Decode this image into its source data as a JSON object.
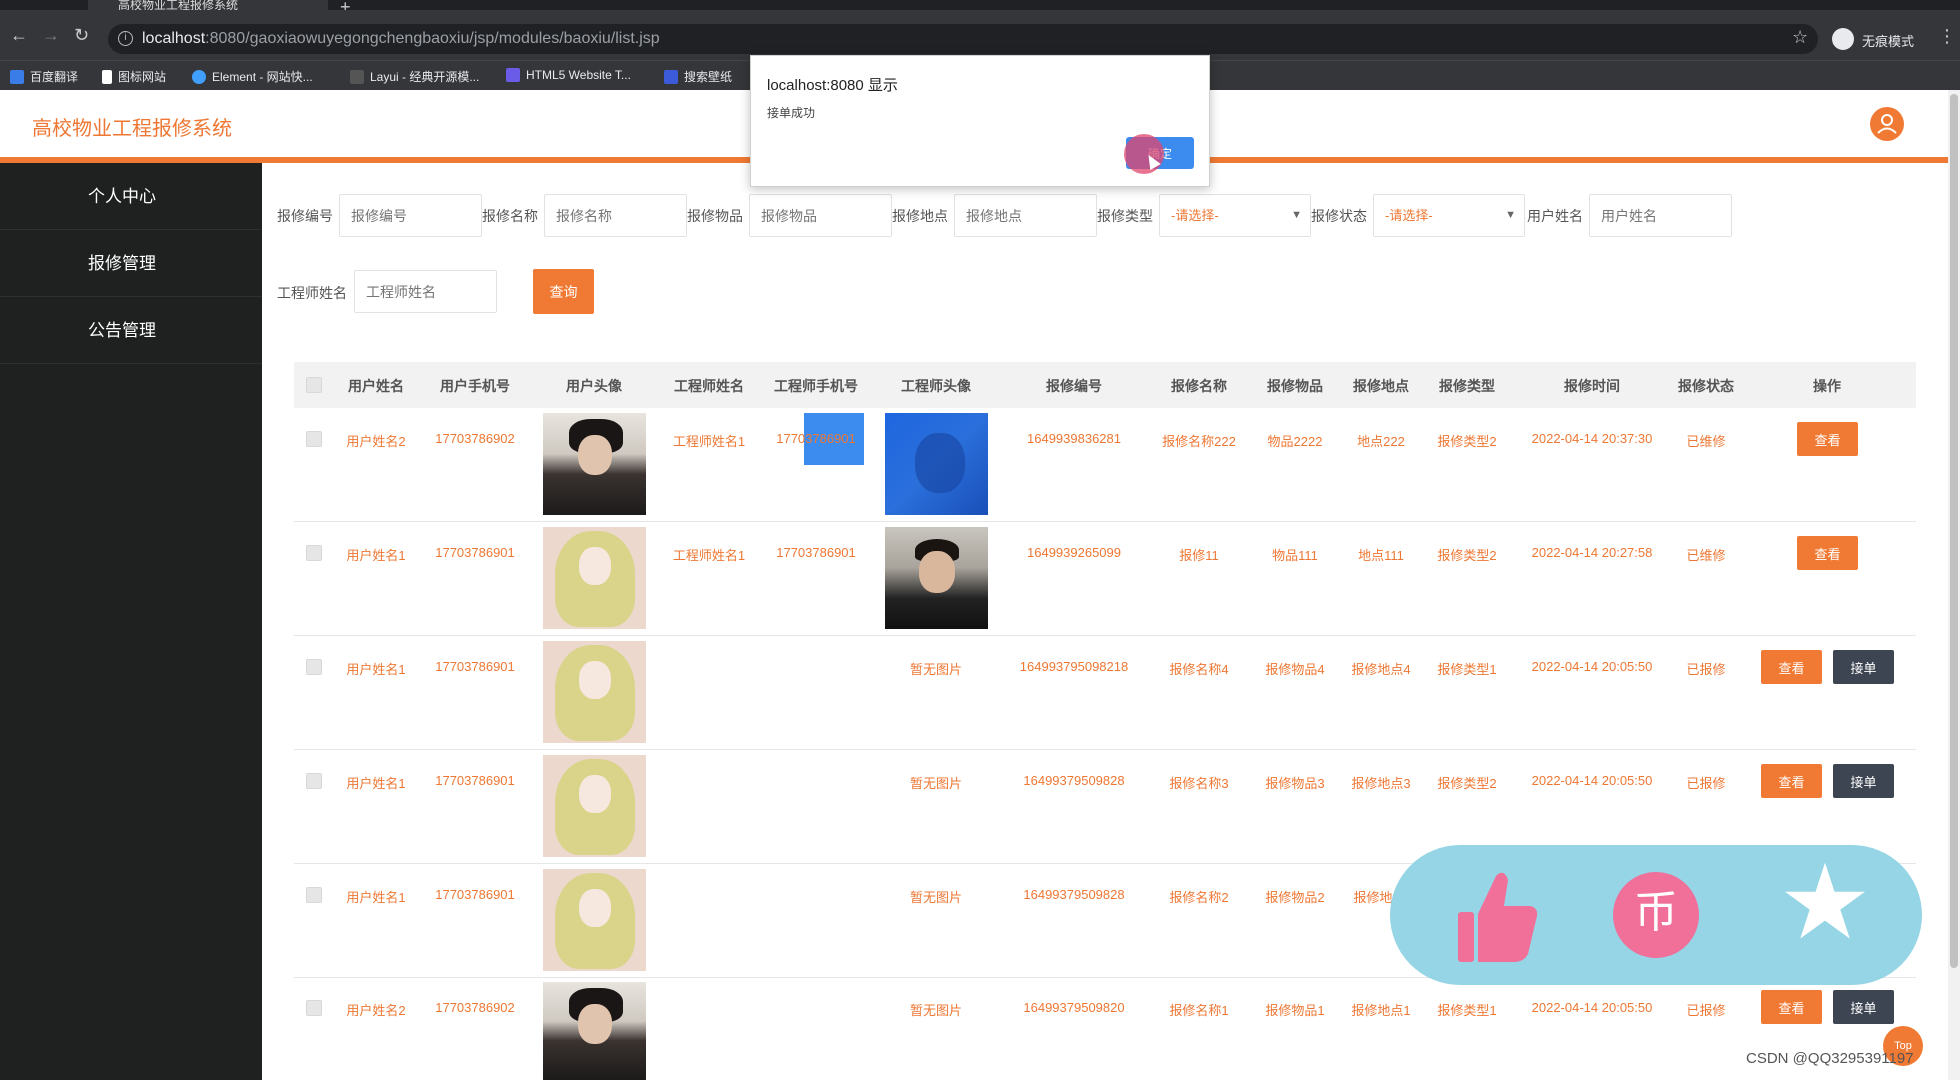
{
  "browser": {
    "tab_title": "高校物业工程报修系统",
    "url_host": "localhost",
    "url_path": ":8080/gaoxiaowuyegongchengbaoxiu/jsp/modules/baoxiu/list.jsp",
    "incognito_label": "无痕模式",
    "bookmarks": [
      "百度翻译",
      "图标网站",
      "Element - 网站快...",
      "Layui - 经典开源模...",
      "HTML5 Website T...",
      "搜索壁纸"
    ]
  },
  "app": {
    "title": "高校物业工程报修系统"
  },
  "sidebar": {
    "items": [
      "个人中心",
      "报修管理",
      "公告管理"
    ]
  },
  "search": {
    "fields": [
      {
        "label": "报修编号",
        "placeholder": "报修编号"
      },
      {
        "label": "报修名称",
        "placeholder": "报修名称"
      },
      {
        "label": "报修物品",
        "placeholder": "报修物品"
      },
      {
        "label": "报修地点",
        "placeholder": "报修地点"
      },
      {
        "label": "报修类型",
        "select": "-请选择-"
      },
      {
        "label": "报修状态",
        "select": "-请选择-"
      },
      {
        "label": "用户姓名",
        "placeholder": "用户姓名"
      },
      {
        "label": "工程师姓名",
        "placeholder": "工程师姓名"
      }
    ],
    "query_label": "查询"
  },
  "table": {
    "headers": [
      "用户姓名",
      "用户手机号",
      "用户头像",
      "工程师姓名",
      "工程师手机号",
      "工程师头像",
      "报修编号",
      "报修名称",
      "报修物品",
      "报修地点",
      "报修类型",
      "报修时间",
      "报修状态",
      "操作"
    ],
    "no_image_text": "暂无图片",
    "view_label": "查看",
    "accept_label": "接单",
    "rows": [
      {
        "user": "用户姓名2",
        "phone": "17703786902",
        "avatar": "man",
        "engineer": "工程师姓名1",
        "eng_phone": "17703786901",
        "eng_avatar": "blue-photo",
        "code": "1649939836281",
        "name": "报修名称222",
        "item": "物品2222",
        "place": "地点222",
        "type": "报修类型2",
        "time": "2022-04-14 20:37:30",
        "status": "已维修",
        "actions": [
          "查看"
        ]
      },
      {
        "user": "用户姓名1",
        "phone": "17703786901",
        "avatar": "girl",
        "engineer": "工程师姓名1",
        "eng_phone": "17703786901",
        "eng_avatar": "man-photo",
        "code": "1649939265099",
        "name": "报修11",
        "item": "物品111",
        "place": "地点111",
        "type": "报修类型2",
        "time": "2022-04-14 20:27:58",
        "status": "已维修",
        "actions": [
          "查看"
        ]
      },
      {
        "user": "用户姓名1",
        "phone": "17703786901",
        "avatar": "girl",
        "engineer": "",
        "eng_phone": "",
        "eng_avatar": "none",
        "code": "164993795098218",
        "name": "报修名称4",
        "item": "报修物品4",
        "place": "报修地点4",
        "type": "报修类型1",
        "time": "2022-04-14 20:05:50",
        "status": "已报修",
        "actions": [
          "查看",
          "接单"
        ]
      },
      {
        "user": "用户姓名1",
        "phone": "17703786901",
        "avatar": "girl",
        "engineer": "",
        "eng_phone": "",
        "eng_avatar": "none",
        "code": "16499379509828",
        "name": "报修名称3",
        "item": "报修物品3",
        "place": "报修地点3",
        "type": "报修类型2",
        "time": "2022-04-14 20:05:50",
        "status": "已报修",
        "actions": [
          "查看",
          "接单"
        ]
      },
      {
        "user": "用户姓名1",
        "phone": "17703786901",
        "avatar": "girl",
        "engineer": "",
        "eng_phone": "",
        "eng_avatar": "none",
        "code": "16499379509828",
        "name": "报修名称2",
        "item": "报修物品2",
        "place": "报修地",
        "type": "",
        "time": "",
        "status": "",
        "actions": []
      },
      {
        "user": "用户姓名2",
        "phone": "17703786902",
        "avatar": "man",
        "engineer": "",
        "eng_phone": "",
        "eng_avatar": "none",
        "code": "16499379509820",
        "name": "报修名称1",
        "item": "报修物品1",
        "place": "报修地点1",
        "type": "报修类型1",
        "time": "2022-04-14 20:05:50",
        "status": "已报修",
        "actions": [
          "查看",
          "接单"
        ]
      }
    ]
  },
  "dialog": {
    "title": "localhost:8080 显示",
    "message": "接单成功",
    "ok_label": "确定"
  },
  "overlay": {
    "coin_glyph": "币"
  },
  "top_button": "Top",
  "watermark": "CSDN @QQ3295391197",
  "colors": {
    "accent": "#f07a33",
    "sidebar": "#1f2020",
    "dialog_button": "#3c8cf0",
    "accept_button": "#3d4552"
  }
}
